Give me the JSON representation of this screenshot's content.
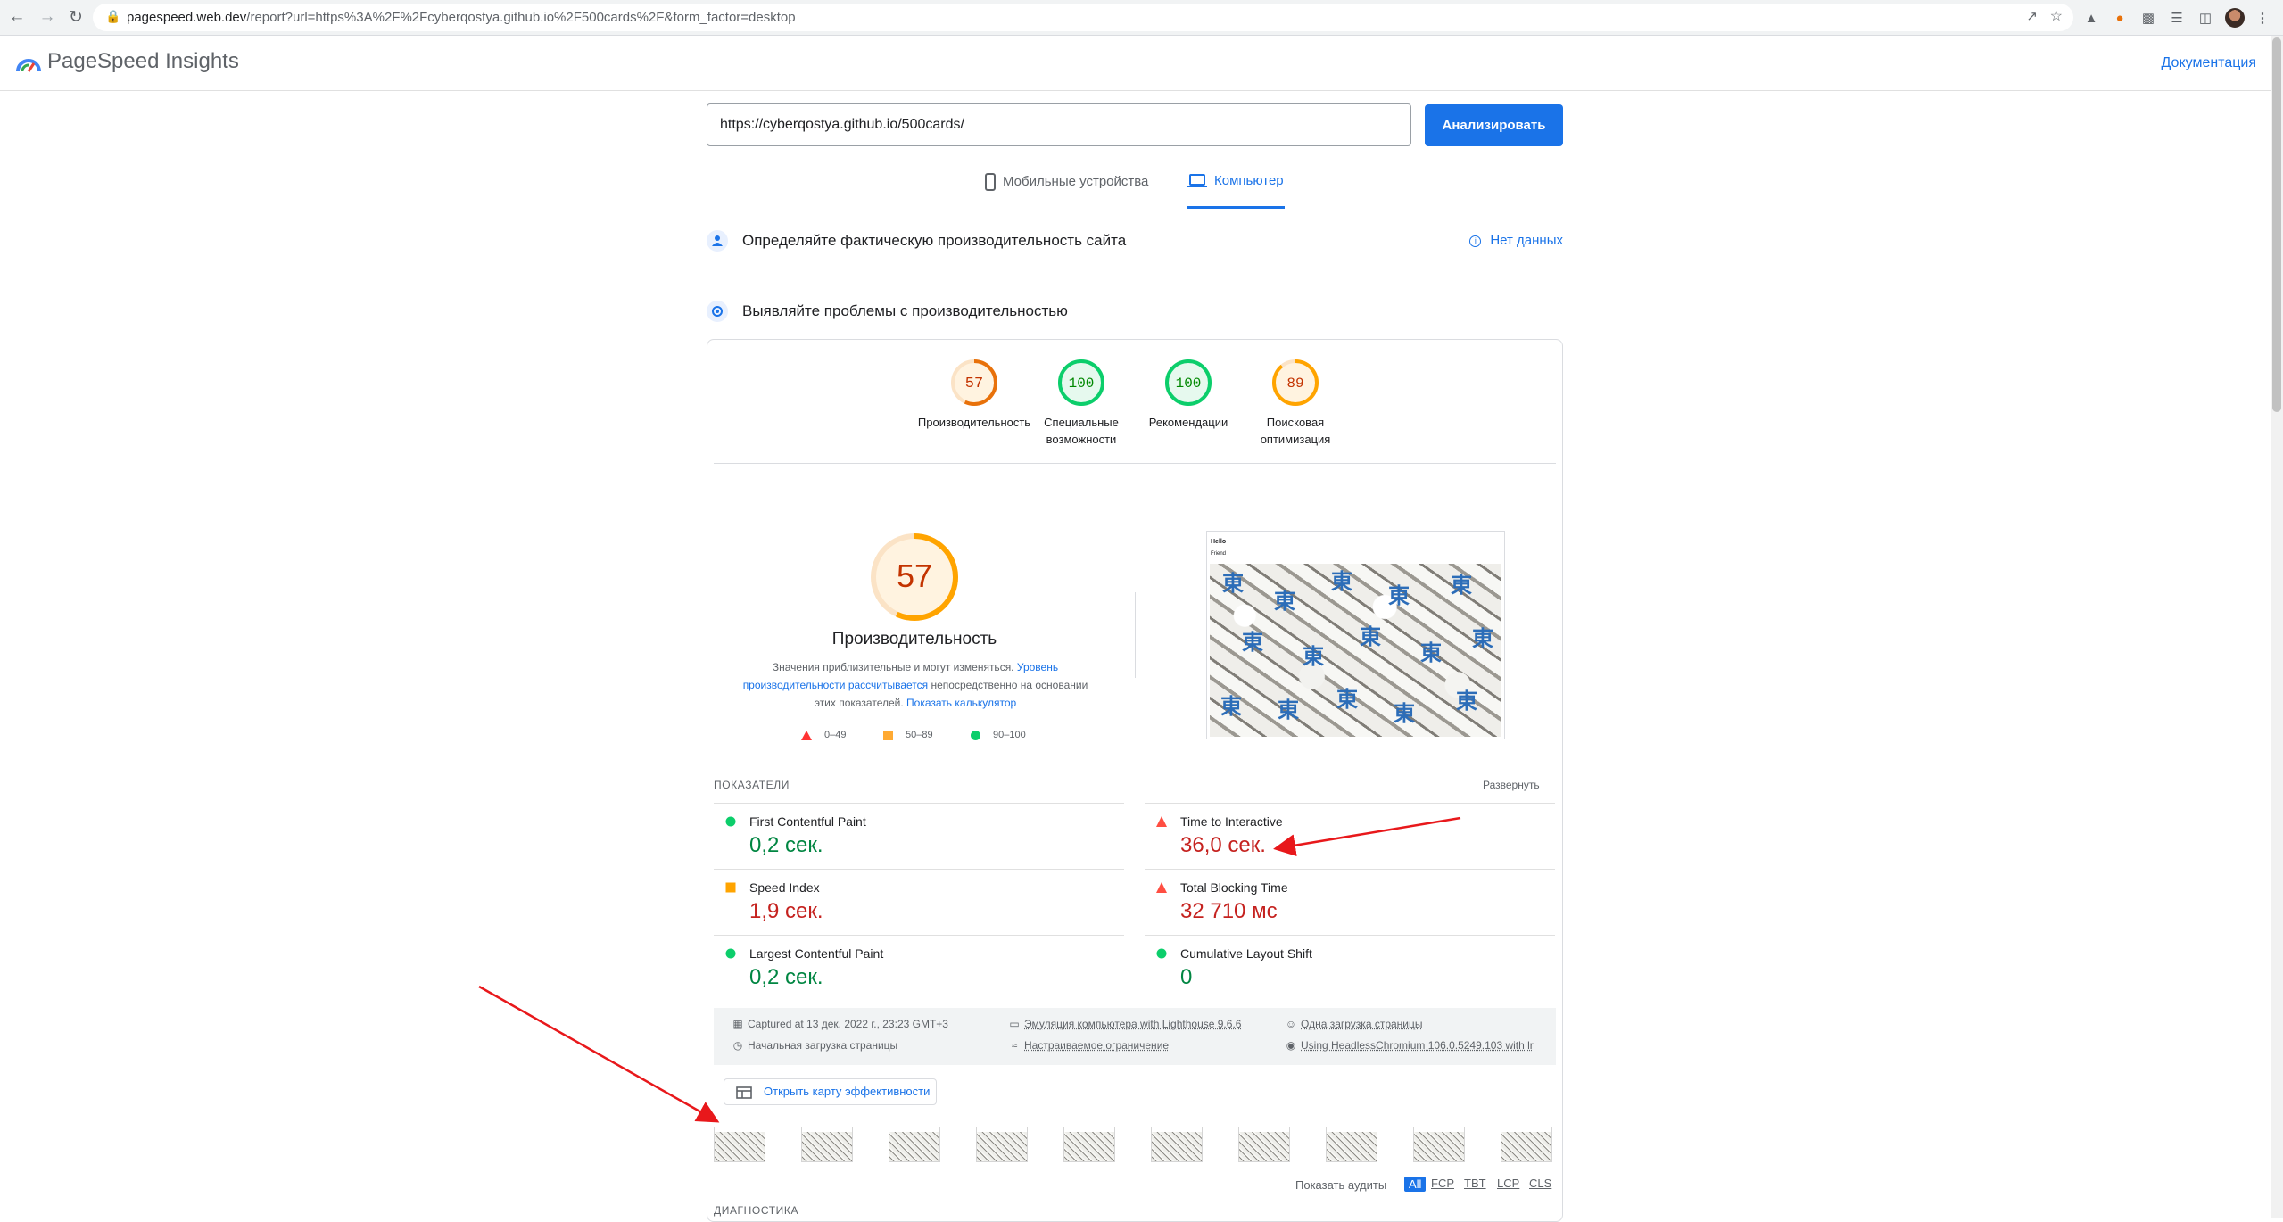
{
  "browser": {
    "url_host": "pagespeed.web.dev",
    "url_rest": "/report?url=https%3A%2F%2Fcyberqostya.github.io%2F500cards%2F&form_factor=desktop"
  },
  "header": {
    "title": "PageSpeed Insights",
    "docs_link": "Документация"
  },
  "search": {
    "url_value": "https://cyberqostya.github.io/500cards/",
    "analyze_label": "Анализировать"
  },
  "device_tabs": {
    "mobile": "Мобильные устройства",
    "desktop": "Компьютер"
  },
  "field_data": {
    "title": "Определяйте фактическую производительность сайта",
    "no_data": "Нет данных"
  },
  "lab": {
    "title": "Выявляйте проблемы с производительностью"
  },
  "categories": [
    {
      "score": 57,
      "label_line1": "Производительность",
      "label_line2": "",
      "color": "#e8710a"
    },
    {
      "score": 100,
      "label_line1": "Специальные",
      "label_line2": "возможности",
      "color": "#0cce6b"
    },
    {
      "score": 100,
      "label_line1": "Рекомендации",
      "label_line2": "",
      "color": "#0cce6b"
    },
    {
      "score": 89,
      "label_line1": "Поисковая",
      "label_line2": "оптимизация",
      "color": "#ffa400"
    }
  ],
  "performance": {
    "score": 57,
    "title": "Производительность",
    "note_part1": "Значения приблизительные и могут изменяться.",
    "note_link1": "Уровень производительности рассчитывается",
    "note_part2": "непосредственно на основании этих показателей.",
    "note_link2": "Показать калькулятор",
    "legend": {
      "red": "0–49",
      "orange": "50–89",
      "green": "90–100"
    },
    "screenshot_text1": "Hello",
    "screenshot_text2": "Friend",
    "screenshot_glyph": "東"
  },
  "metrics": {
    "section_label": "ПОКАЗАТЕЛИ",
    "expand": "Развернуть",
    "items": [
      {
        "name": "First Contentful Paint",
        "value": "0,2 сек.",
        "status": "good"
      },
      {
        "name": "Time to Interactive",
        "value": "36,0 сек.",
        "status": "poor"
      },
      {
        "name": "Speed Index",
        "value": "1,9 сек.",
        "status": "average"
      },
      {
        "name": "Total Blocking Time",
        "value": "32 710 мс",
        "status": "poor"
      },
      {
        "name": "Largest Contentful Paint",
        "value": "0,2 сек.",
        "status": "good"
      },
      {
        "name": "Cumulative Layout Shift",
        "value": "0",
        "status": "good"
      }
    ]
  },
  "runtime": {
    "captured": "Captured at 13 дек. 2022 г., 23:23 GMT+3",
    "emulation": "Эмуляция компьютера with Lighthouse 9.6.6",
    "single_load": "Одна загрузка страницы",
    "initial_load": "Начальная загрузка страницы",
    "throttling": "Настраиваемое ограничение",
    "browser": "Using HeadlessChromium 106.0.5249.103 with lr"
  },
  "treemap_label": "Открыть карту эффективности",
  "audit_filter": {
    "label": "Показать аудиты",
    "options": [
      "All",
      "FCP",
      "TBT",
      "LCP",
      "CLS"
    ]
  },
  "diagnostics_label": "ДИАГНОСТИКА",
  "colors": {
    "accent": "#1a73e8",
    "good": "#0cce6b",
    "average": "#ffa400",
    "poor": "#ff4e42",
    "arrow": "#e8181b"
  }
}
